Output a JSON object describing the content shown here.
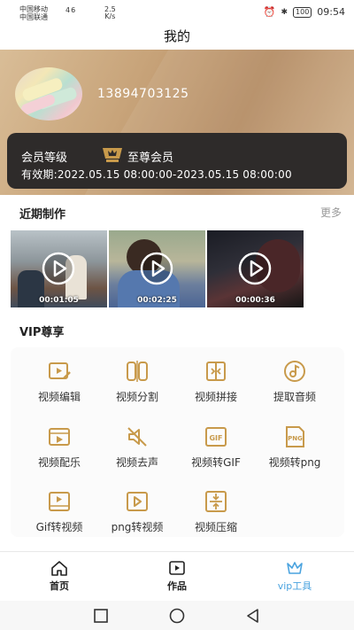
{
  "status_bar": {
    "carrier1": "中国移动",
    "carrier2": "中国联通",
    "network": "46",
    "speed_value": "2.5",
    "speed_unit": "K/s",
    "battery": "100",
    "time": "09:54"
  },
  "header": {
    "title": "我的"
  },
  "profile": {
    "phone": "13894703125",
    "member_label": "会员等级",
    "member_level": "至尊会员",
    "validity": "有效期:2022.05.15 08:00:00-2023.05.15 08:00:00"
  },
  "recent": {
    "title": "近期制作",
    "more_label": "更多",
    "videos": [
      {
        "duration": "00:01:05"
      },
      {
        "duration": "00:02:25"
      },
      {
        "duration": "00:00:36"
      }
    ]
  },
  "vip": {
    "title": "VIP尊享",
    "accent_color": "#c89a4b",
    "tools": [
      {
        "label": "视频编辑",
        "icon": "video-edit-icon"
      },
      {
        "label": "视频分割",
        "icon": "video-split-icon"
      },
      {
        "label": "视频拼接",
        "icon": "video-merge-icon"
      },
      {
        "label": "提取音频",
        "icon": "extract-audio-icon"
      },
      {
        "label": "视频配乐",
        "icon": "video-music-icon"
      },
      {
        "label": "视频去声",
        "icon": "mute-icon"
      },
      {
        "label": "视频转GIF",
        "icon": "gif-icon"
      },
      {
        "label": "视频转png",
        "icon": "png-icon"
      },
      {
        "label": "Gif转视频",
        "icon": "gif-to-video-icon"
      },
      {
        "label": "png转视频",
        "icon": "png-to-video-icon"
      },
      {
        "label": "视频压缩",
        "icon": "compress-icon"
      }
    ]
  },
  "tabbar": {
    "active_color": "#4aa3df",
    "tabs": [
      {
        "label": "首页",
        "icon": "home-icon"
      },
      {
        "label": "作品",
        "icon": "works-icon"
      },
      {
        "label": "vip工具",
        "icon": "vip-crown-icon"
      }
    ]
  }
}
